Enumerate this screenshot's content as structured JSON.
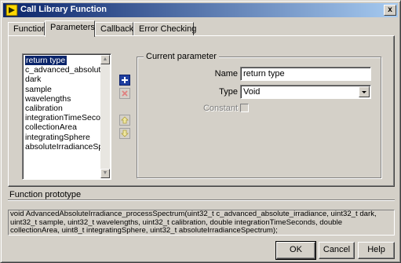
{
  "window": {
    "title": "Call Library Function",
    "close_glyph": "x"
  },
  "tabs": [
    {
      "label": "Function"
    },
    {
      "label": "Parameters"
    },
    {
      "label": "Callbacks"
    },
    {
      "label": "Error Checking"
    }
  ],
  "parameters_list": {
    "items": [
      "return type",
      "c_advanced_absolute_irradiance",
      "dark",
      "sample",
      "wavelengths",
      "calibration",
      "integrationTimeSeconds",
      "collectionArea",
      "integratingSphere",
      "absoluteIrradianceSpectrum"
    ],
    "selected_index": 0
  },
  "toolbar": {
    "add_icon": "plus-icon",
    "delete_icon": "x-icon",
    "move_up_icon": "arrow-up-icon",
    "move_down_icon": "arrow-down-icon"
  },
  "current_parameter": {
    "group_label": "Current parameter",
    "name_label": "Name",
    "name_value": "return type",
    "type_label": "Type",
    "type_value": "Void",
    "constant_label": "Constant",
    "constant_checked": false
  },
  "prototype": {
    "label": "Function prototype",
    "text": "void  AdvancedAbsoluteIrradiance_processSpectrum(uint32_t c_advanced_absolute_irradiance, uint32_t dark, uint32_t sample, uint32_t wavelengths, uint32_t calibration, double integrationTimeSeconds, double collectionArea, uint8_t integratingSphere, uint32_t absoluteIrradianceSpectrum);"
  },
  "buttons": {
    "ok": "OK",
    "cancel": "Cancel",
    "help": "Help"
  }
}
